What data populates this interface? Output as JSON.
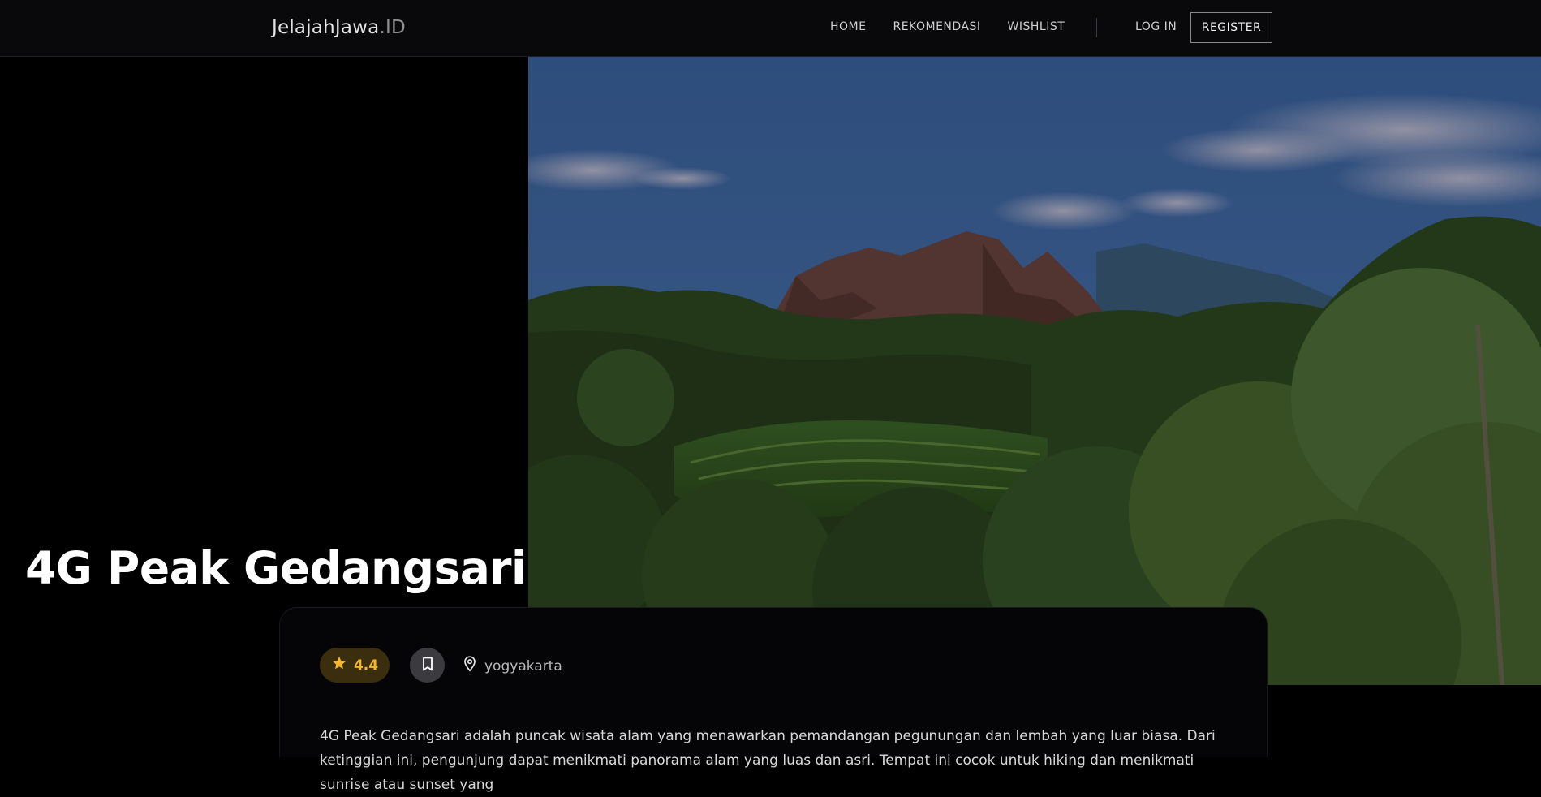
{
  "brand": {
    "name": "JelajahJawa",
    "suffix": ".ID"
  },
  "nav": {
    "items": [
      "HOME",
      "REKOMENDASI",
      "WISHLIST"
    ],
    "login_label": "LOG IN",
    "register_label": "REGISTER"
  },
  "place": {
    "title": "4G Peak Gedangsari",
    "rating": "4.4",
    "location": "yogyakarta",
    "description": "4G Peak Gedangsari adalah puncak wisata alam yang menawarkan pemandangan pegunungan dan lembah yang luar biasa. Dari ketinggian ini, pengunjung dapat menikmati panorama alam yang luas dan asri. Tempat ini cocok untuk hiking dan menikmati sunrise atau sunset yang"
  },
  "icons": {
    "rating": "star-icon",
    "wishlist": "bookmark-icon",
    "location": "map-pin-icon"
  },
  "colors": {
    "background": "#000000",
    "rating_accent": "#f2b632",
    "rating_bg": "#3a2e0e",
    "card_bg": "#050507"
  }
}
